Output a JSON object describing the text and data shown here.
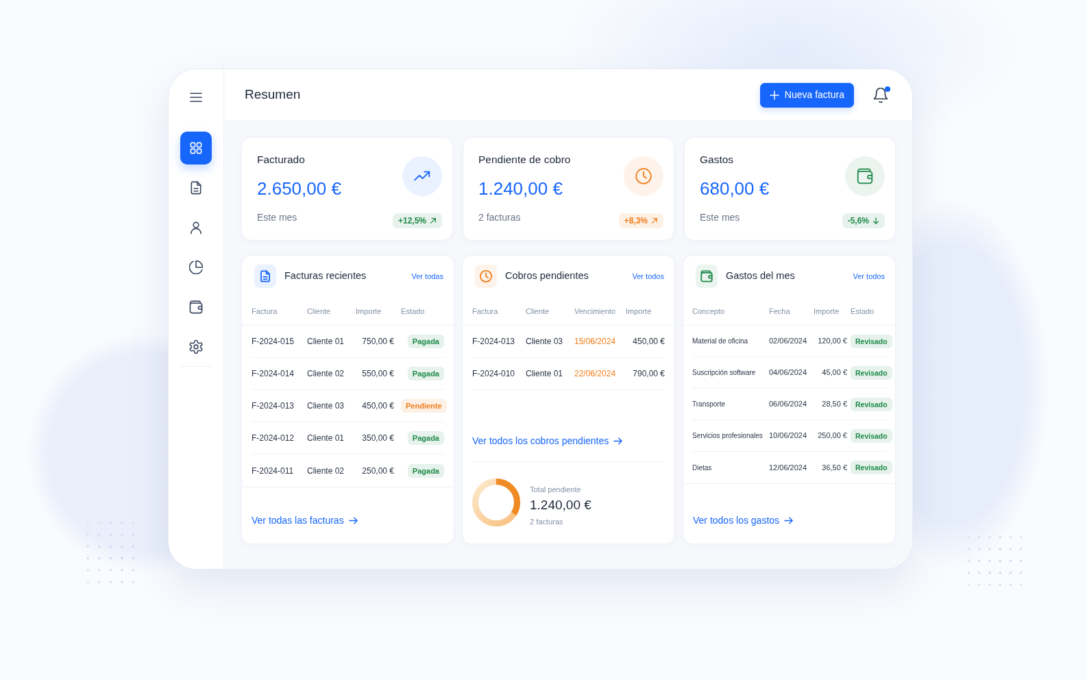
{
  "sidebar": {
    "items": [
      {
        "kind": "grid",
        "selected": true
      },
      {
        "kind": "document",
        "selected": false
      },
      {
        "kind": "person",
        "selected": false
      },
      {
        "kind": "chart",
        "selected": false
      },
      {
        "kind": "wallet",
        "selected": false
      },
      {
        "kind": "gear",
        "selected": false
      }
    ]
  },
  "header": {
    "title": "Resumen",
    "action_button": "Nueva factura",
    "notifications": {
      "unread": true
    }
  },
  "stats": [
    {
      "title": "Facturado",
      "value": "2.650,00 €",
      "caption": "Este mes",
      "icon": {
        "kind": "trend",
        "color": "#1766fb"
      },
      "change": {
        "text": "+12,5%",
        "rising": true,
        "color": "#1e8a4a"
      }
    },
    {
      "title": "Pendiente de cobro",
      "value": "1.240,00 €",
      "caption": "2 facturas",
      "icon": {
        "kind": "clock",
        "color": "#f07d1a"
      },
      "change": {
        "text": "+8,3%",
        "rising": true,
        "color": "#f07d1a"
      }
    },
    {
      "title": "Gastos",
      "value": "680,00 €",
      "caption": "Este mes",
      "icon": {
        "kind": "wallet",
        "color": "#1e8a4a"
      },
      "change": {
        "text": "-5,6%",
        "rising": false,
        "color": "#1e8a4a"
      }
    }
  ],
  "panels": [
    {
      "title": "Facturas recientes",
      "icon": {
        "kind": "document",
        "color": "#1766fb"
      },
      "header_link": "Ver todas",
      "columns": [
        {
          "label": "Factura",
          "kind": "text"
        },
        {
          "label": "Cliente",
          "kind": "text"
        },
        {
          "label": "Importe",
          "kind": "amount"
        },
        {
          "label": "Estado",
          "kind": "status"
        }
      ],
      "rows": [
        [
          "F-2024-015",
          "Cliente 01",
          "750,00 €",
          {
            "text": "Pagada",
            "color": "#1e8a4a"
          }
        ],
        [
          "F-2024-014",
          "Cliente 02",
          "550,00 €",
          {
            "text": "Pagada",
            "color": "#1e8a4a"
          }
        ],
        [
          "F-2024-013",
          "Cliente 03",
          "450,00 €",
          {
            "text": "Pendiente",
            "color": "#f07d1a"
          }
        ],
        [
          "F-2024-012",
          "Cliente 01",
          "350,00 €",
          {
            "text": "Pagada",
            "color": "#1e8a4a"
          }
        ],
        [
          "F-2024-011",
          "Cliente 02",
          "250,00 €",
          {
            "text": "Pagada",
            "color": "#1e8a4a"
          }
        ]
      ],
      "footer_link": "Ver todas las facturas"
    },
    {
      "title": "Cobros pendientes",
      "icon": {
        "kind": "clock",
        "color": "#f07d1a"
      },
      "header_link": "Ver todos",
      "columns": [
        {
          "label": "Factura",
          "kind": "text"
        },
        {
          "label": "Cliente",
          "kind": "text"
        },
        {
          "label": "Vencimiento",
          "kind": "due"
        },
        {
          "label": "Importe",
          "kind": "amount"
        }
      ],
      "rows": [
        [
          "F-2024-013",
          "Cliente 03",
          "15/06/2024",
          "450,00 €"
        ],
        [
          "F-2024-010",
          "Cliente 01",
          "22/06/2024",
          "790,00 €"
        ]
      ],
      "footer_link": "Ver todos los cobros pendientes",
      "summary": {
        "label": "Total pendiente",
        "value": "1.240,00 €",
        "caption": "2 facturas"
      }
    },
    {
      "title": "Gastos del mes",
      "icon": {
        "kind": "wallet",
        "color": "#1e8a4a"
      },
      "header_link": "Ver todos",
      "columns": [
        {
          "label": "Concepto",
          "kind": "text"
        },
        {
          "label": "Fecha",
          "kind": "date"
        },
        {
          "label": "Importe",
          "kind": "amount"
        },
        {
          "label": "Estado",
          "kind": "status"
        }
      ],
      "rows": [
        [
          "Material de oficina",
          "02/06/2024",
          "120,00 €",
          {
            "text": "Revisado",
            "color": "#1e8a4a"
          }
        ],
        [
          "Suscripción software",
          "04/06/2024",
          "45,00 €",
          {
            "text": "Revisado",
            "color": "#1e8a4a"
          }
        ],
        [
          "Transporte",
          "06/06/2024",
          "28,50 €",
          {
            "text": "Revisado",
            "color": "#1e8a4a"
          }
        ],
        [
          "Servicios profesionales",
          "10/06/2024",
          "250,00 €",
          {
            "text": "Revisado",
            "color": "#1e8a4a"
          }
        ],
        [
          "Dietas",
          "12/06/2024",
          "36,50 €",
          {
            "text": "Revisado",
            "color": "#1e8a4a"
          }
        ]
      ],
      "footer_link": "Ver todos los gastos"
    }
  ]
}
